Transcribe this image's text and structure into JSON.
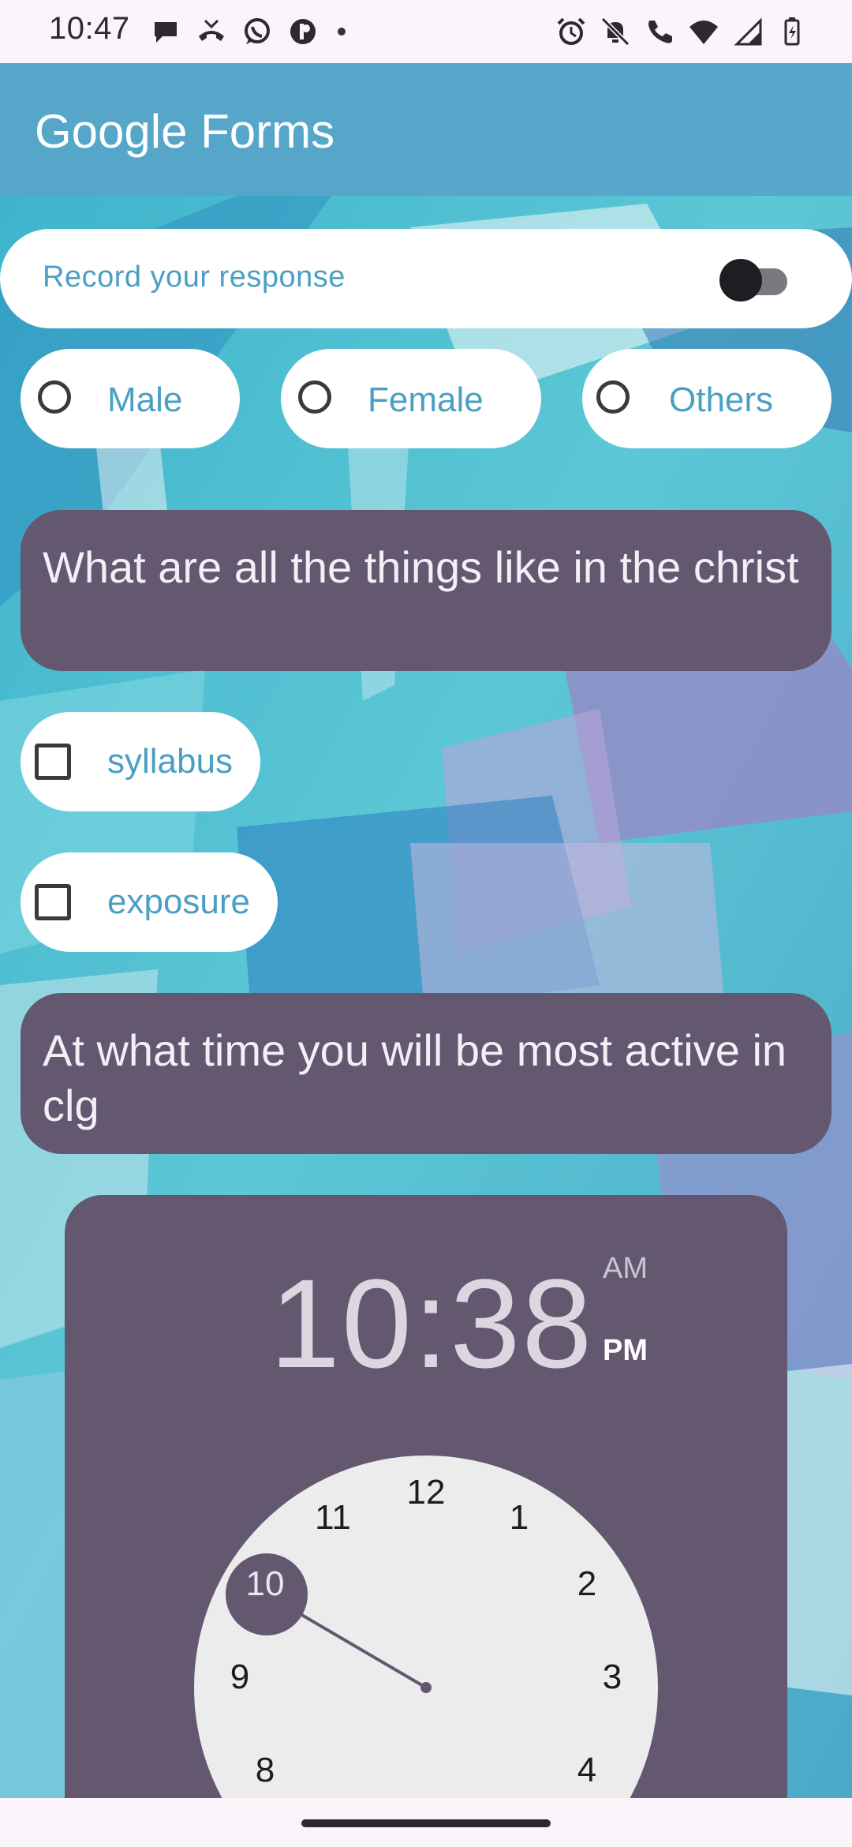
{
  "status_bar": {
    "time": "10:47",
    "left_icons": [
      "chat-bubble-icon",
      "call-missed-icon",
      "whatsapp-icon",
      "app-icon",
      "dot-icon"
    ],
    "right_icons": [
      "alarm-icon",
      "mute-icon",
      "wifi-calling-icon",
      "wifi-icon",
      "lte-signal-icon",
      "battery-icon"
    ],
    "network": "LTE"
  },
  "app_bar": {
    "title": "Google Forms",
    "color": "#56a6c9"
  },
  "record": {
    "label": "Record your response",
    "enabled": false
  },
  "gender_options": [
    {
      "label": "Male",
      "selected": false
    },
    {
      "label": "Female",
      "selected": false
    },
    {
      "label": "Others",
      "selected": false
    }
  ],
  "question1": {
    "text": "What are all the things like in the christ"
  },
  "checkbox_options": [
    {
      "label": "syllabus",
      "checked": false
    },
    {
      "label": "exposure",
      "checked": false
    }
  ],
  "question2": {
    "text": "At what time you will be most active in clg"
  },
  "time_picker": {
    "time": "10:38",
    "am_label": "AM",
    "pm_label": "PM",
    "selected_period": "PM",
    "selected_hour": "10",
    "hours": [
      "12",
      "1",
      "2",
      "3",
      "4",
      "8",
      "9",
      "10",
      "11"
    ]
  },
  "colors": {
    "accent_text": "#4a9fc3",
    "card": "#63586f",
    "clock_face": "#ececec"
  }
}
